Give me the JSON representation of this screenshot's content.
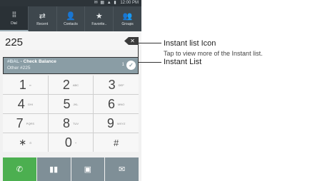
{
  "status_bar": {
    "time": "12:00 PM",
    "icons": "✉ ▦ ▲ ▮"
  },
  "tabs": [
    {
      "label": "Dial",
      "icon": "⁞⁞⁞",
      "active": true
    },
    {
      "label": "Recent",
      "icon": "⇄"
    },
    {
      "label": "Contacts",
      "icon": "👤"
    },
    {
      "label": "Favorite..",
      "icon": "★"
    },
    {
      "label": "Groups",
      "icon": "👥"
    }
  ],
  "dialed_number": "225",
  "backspace_icon": "✕",
  "instant_list": {
    "code": "#BAL",
    "title": " - Check Balance",
    "subtitle": "Other #225",
    "count": "1",
    "icon": "✓"
  },
  "keypad": [
    {
      "digit": "1",
      "letters": "∞"
    },
    {
      "digit": "2",
      "letters": "ABC"
    },
    {
      "digit": "3",
      "letters": "DEF"
    },
    {
      "digit": "4",
      "letters": "GHI"
    },
    {
      "digit": "5",
      "letters": "JKL"
    },
    {
      "digit": "6",
      "letters": "MNO"
    },
    {
      "digit": "7",
      "letters": "PQRS"
    },
    {
      "digit": "8",
      "letters": "TUV"
    },
    {
      "digit": "9",
      "letters": "WXYZ"
    },
    {
      "digit": "∗",
      "letters": "⊙"
    },
    {
      "digit": "0",
      "letters": "+"
    },
    {
      "digit": "#",
      "letters": ""
    }
  ],
  "actions": [
    {
      "name": "call-button",
      "icon": "✆"
    },
    {
      "name": "voicemail-button",
      "icon": "▮▮"
    },
    {
      "name": "video-call-button",
      "icon": "▣"
    },
    {
      "name": "message-button",
      "icon": "✉"
    }
  ],
  "callouts": {
    "instant_list_icon_title": "Instant list Icon",
    "instant_list_icon_desc": "Tap to view more of the Instant list.",
    "instant_list_title": "Instant List"
  }
}
